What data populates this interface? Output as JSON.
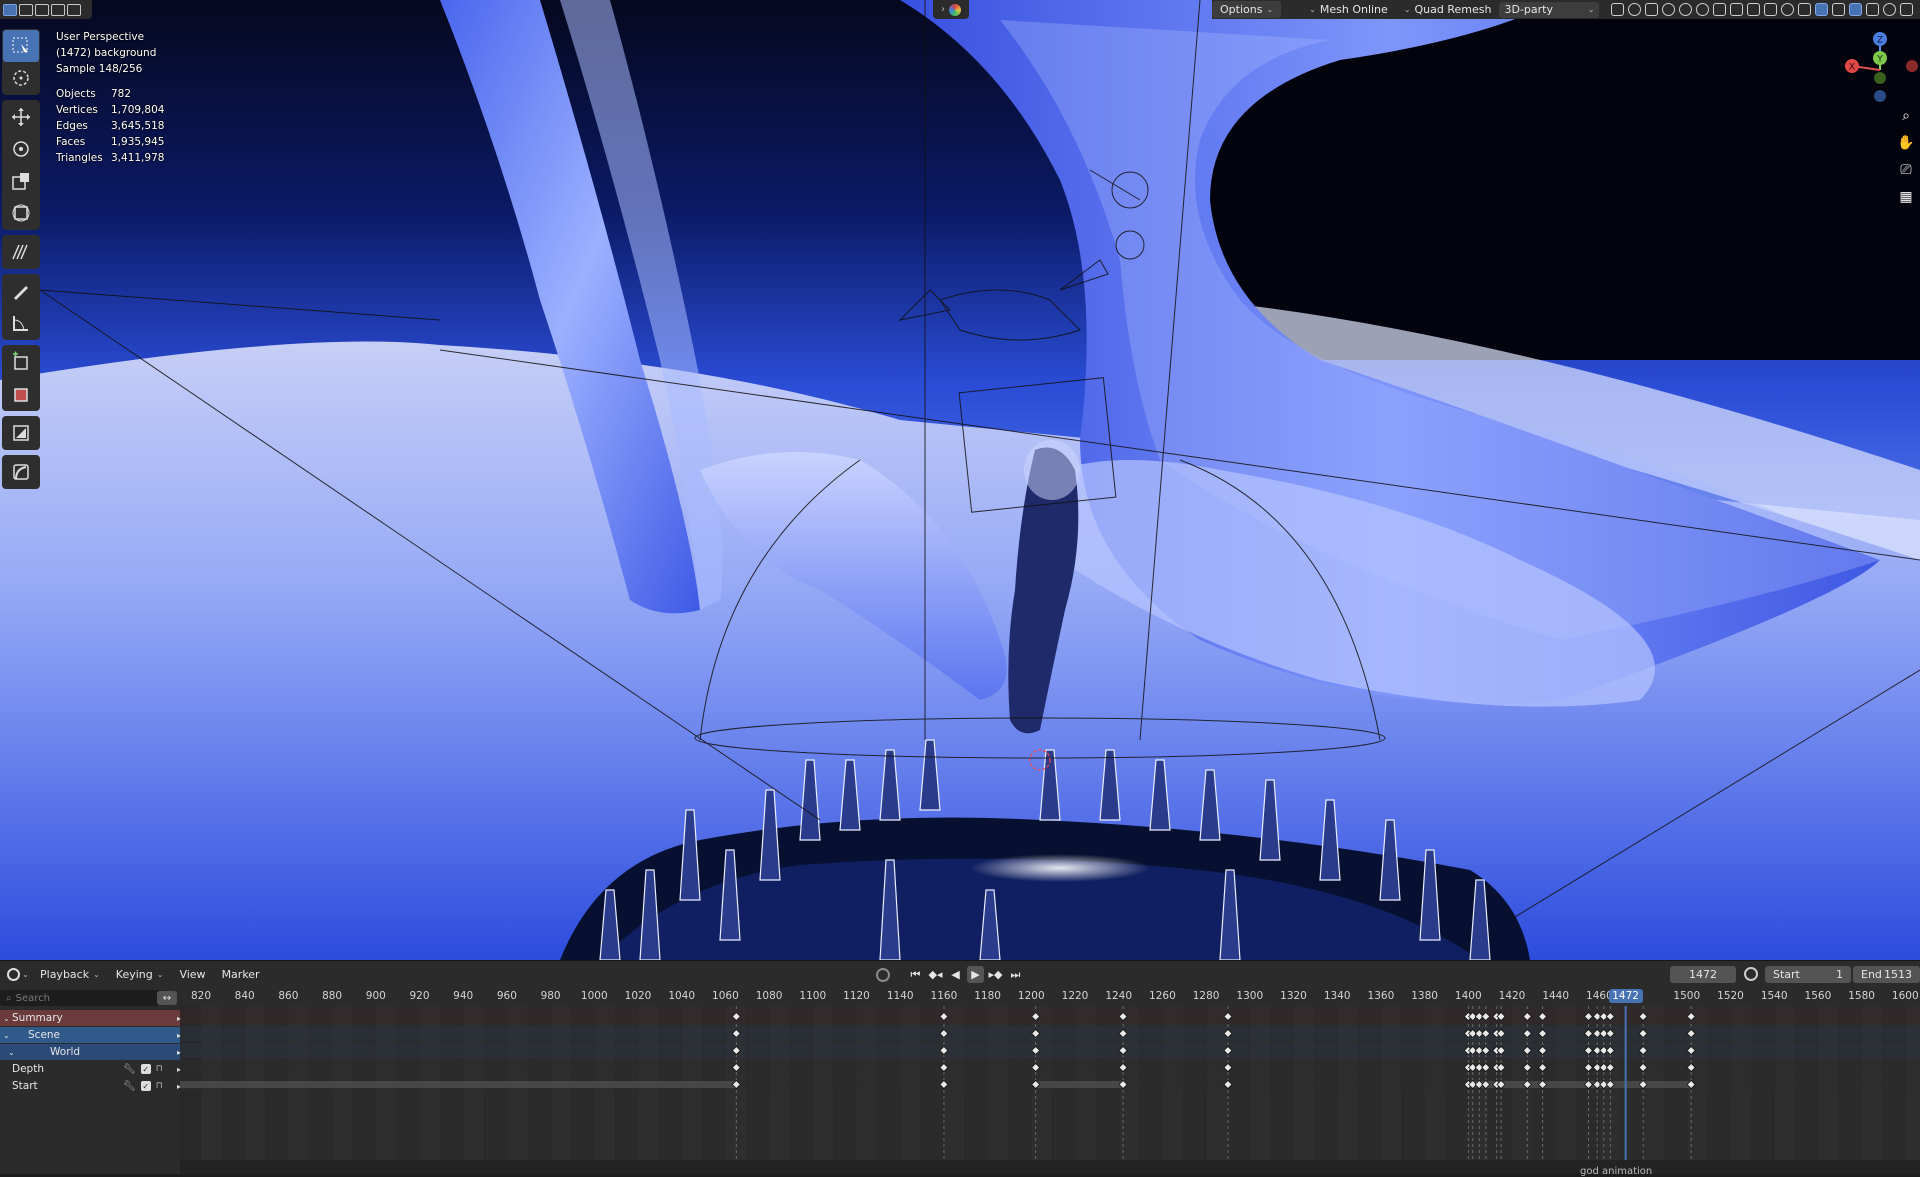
{
  "viewport": {
    "overlay": {
      "line1": "User Perspective",
      "line2": "(1472) background",
      "line3": "Sample 148/256",
      "stats": [
        {
          "k": "Objects",
          "v": "782"
        },
        {
          "k": "Vertices",
          "v": "1,709,804"
        },
        {
          "k": "Edges",
          "v": "3,645,518"
        },
        {
          "k": "Faces",
          "v": "1,935,945"
        },
        {
          "k": "Triangles",
          "v": "3,411,978"
        }
      ]
    },
    "header": {
      "options_label": "Options",
      "mesh_online_label": "Mesh Online",
      "quad_remesh_label": "Quad Remesh",
      "third_party_label": "3D-party"
    },
    "gizmo": {
      "z": "Z",
      "y": "Y",
      "x": "X"
    },
    "toolbar_icons": [
      "select-box-icon",
      "cursor-icon",
      "move-icon",
      "rotate-icon",
      "scale-icon",
      "transform-icon",
      "annotate-icon",
      "pencil-icon",
      "measure-icon",
      "add-cube-icon",
      "spin-icon",
      "shrink-icon",
      "edge-icon"
    ],
    "colors": {
      "accent": "#4772b3",
      "ribbon": "#6a86f5",
      "sky_dark": "#05081e"
    }
  },
  "timeline": {
    "menus": [
      "Playback",
      "Keying",
      "View",
      "Marker"
    ],
    "current_frame": "1472",
    "start_label": "Start",
    "start_value": "1",
    "end_label": "End",
    "end_value": "1513",
    "search_placeholder": "Search",
    "channels": [
      {
        "label": "Summary"
      },
      {
        "label": "Scene"
      },
      {
        "label": "World"
      },
      {
        "label": "Depth"
      },
      {
        "label": "Start"
      }
    ],
    "ticks": [
      "820",
      "840",
      "860",
      "880",
      "900",
      "920",
      "940",
      "960",
      "980",
      "1000",
      "1020",
      "1040",
      "1060",
      "1080",
      "1100",
      "1120",
      "1140",
      "1160",
      "1180",
      "1200",
      "1220",
      "1240",
      "1260",
      "1280",
      "1300",
      "1320",
      "1340",
      "1360",
      "1380",
      "1400",
      "1420",
      "1440",
      "1460",
      "1480",
      "1500",
      "1520",
      "1540",
      "1560",
      "1580",
      "1600"
    ],
    "playhead_frame": 1472,
    "keyframes": [
      1065,
      1160,
      1202,
      1242,
      1290,
      1400,
      1402,
      1405,
      1408,
      1413,
      1415,
      1427,
      1434,
      1455,
      1459,
      1462,
      1465,
      1480,
      1502
    ],
    "marker_label": "god animation"
  }
}
